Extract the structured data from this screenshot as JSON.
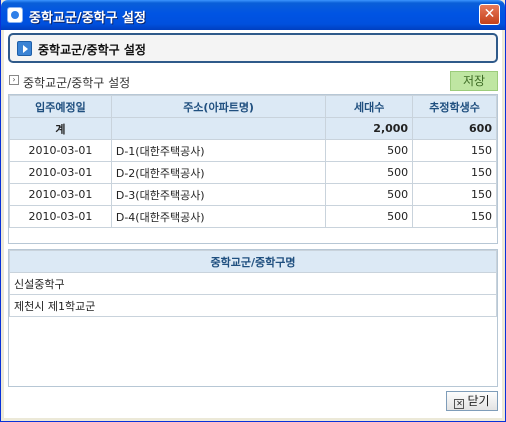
{
  "window": {
    "title": "중학교군/중학구 설정",
    "close_glyph": "✕"
  },
  "header": {
    "title": "중학교군/중학구 설정"
  },
  "section": {
    "label": "중학교군/중학구 설정",
    "save_label": "저장"
  },
  "grid": {
    "columns": [
      "입주예정일",
      "주소(아파트명)",
      "세대수",
      "추정학생수"
    ],
    "summary": {
      "label": "계",
      "households": "2,000",
      "students": "600"
    },
    "rows": [
      {
        "date": "2010-03-01",
        "address": "D-1(대한주택공사)",
        "households": "500",
        "students": "150"
      },
      {
        "date": "2010-03-01",
        "address": "D-2(대한주택공사)",
        "households": "500",
        "students": "150"
      },
      {
        "date": "2010-03-01",
        "address": "D-3(대한주택공사)",
        "households": "500",
        "students": "150"
      },
      {
        "date": "2010-03-01",
        "address": "D-4(대한주택공사)",
        "households": "500",
        "students": "150"
      }
    ]
  },
  "districts": {
    "column": "중학교군/중학구명",
    "rows": [
      "신설중학구",
      "제천시 제1학교군"
    ]
  },
  "footer": {
    "close_label": "닫기"
  }
}
